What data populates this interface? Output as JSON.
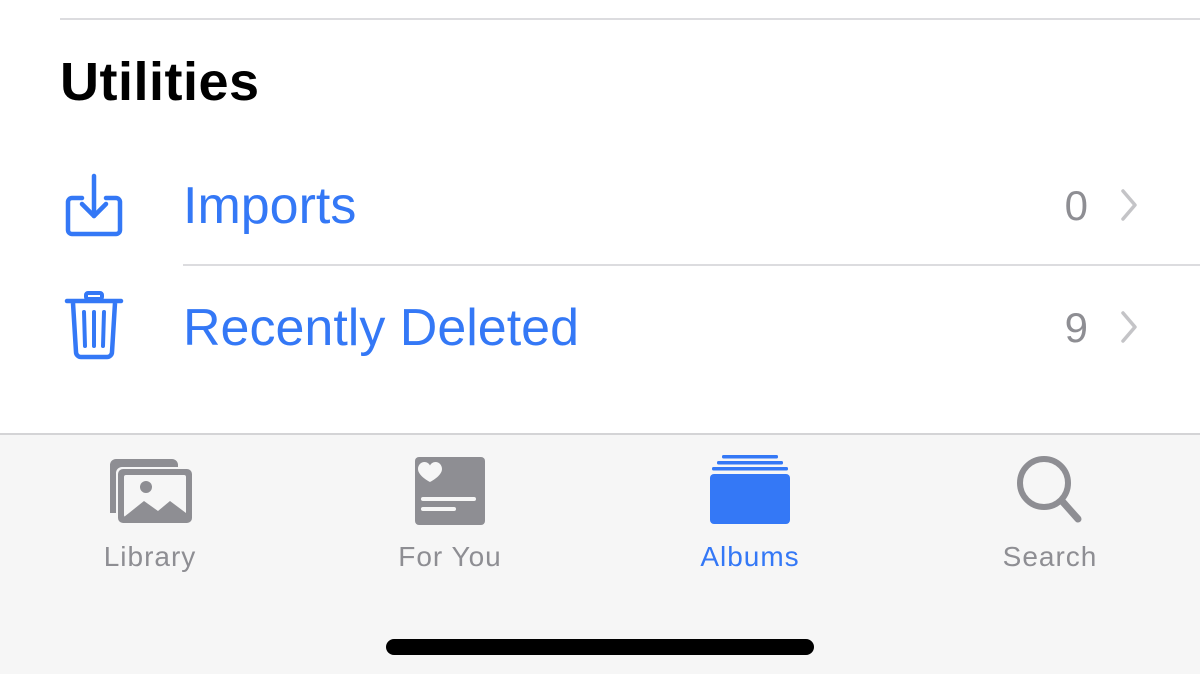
{
  "section": {
    "title": "Utilities"
  },
  "rows": [
    {
      "label": "Imports",
      "count": "0",
      "icon": "import-tray-icon"
    },
    {
      "label": "Recently Deleted",
      "count": "9",
      "icon": "trash-icon"
    }
  ],
  "tabbar": {
    "tabs": [
      {
        "label": "Library",
        "icon": "photo-stack-icon",
        "active": false
      },
      {
        "label": "For You",
        "icon": "heart-card-icon",
        "active": false
      },
      {
        "label": "Albums",
        "icon": "album-stack-icon",
        "active": true
      },
      {
        "label": "Search",
        "icon": "magnifier-icon",
        "active": false
      }
    ]
  },
  "colors": {
    "accent": "#3478f6",
    "inactive": "#8e8e93",
    "tabbar_background": "#f6f6f6"
  }
}
